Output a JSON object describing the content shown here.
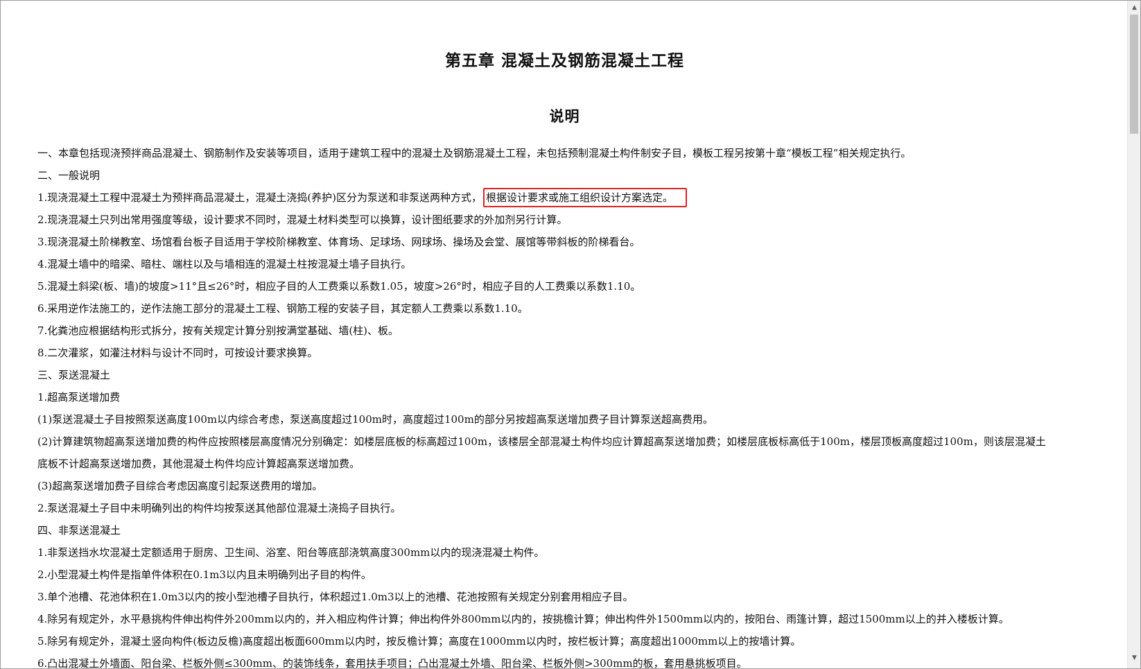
{
  "document": {
    "chapter_title": "第五章  混凝土及钢筋混凝土工程",
    "section_title": "说明",
    "lines": [
      "一、本章包括现浇预拌商品混凝土、钢筋制作及安装等项目，适用于建筑工程中的混凝土及钢筋混凝土工程，未包括预制混凝土构件制安子目，模板工程另按第十章“模板工程”相关规定执行。",
      "二、一般说明",
      "1.现浇混凝土工程中混凝土为预拌商品混凝土，混凝土浇捣(养护)区分为泵送和非泵送两种方式，",
      "2.现浇混凝土只列出常用强度等级，设计要求不同时，混凝土材料类型可以换算，设计图纸要求的外加剂另行计算。",
      "3.现浇混凝土阶梯教室、场馆看台板子目适用于学校阶梯教室、体育场、足球场、网球场、操场及会堂、展馆等带斜板的阶梯看台。",
      "4.混凝土墙中的暗梁、暗柱、端柱以及与墙相连的混凝土柱按混凝土墙子目执行。",
      "5.混凝土斜梁(板、墙)的坡度>11°且≤26°时，相应子目的人工费乘以系数1.05，坡度>26°时，相应子目的人工费乘以系数1.10。",
      "6.采用逆作法施工的，逆作法施工部分的混凝土工程、钢筋工程的安装子目，其定额人工费乘以系数1.10。",
      "7.化粪池应根据结构形式拆分，按有关规定计算分别按满堂基础、墙(柱)、板。",
      "8.二次灌浆，如灌注材料与设计不同时，可按设计要求换算。",
      "三、泵送混凝土",
      "1.超高泵送增加费",
      "(1)泵送混凝土子目按照泵送高度100m以内综合考虑，泵送高度超过100m时，高度超过100m的部分另按超高泵送增加费子目计算泵送超高费用。",
      "(2)计算建筑物超高泵送增加费的构件应按照楼层高度情况分别确定：如楼层底板的标高超过100m，该楼层全部混凝土构件均应计算超高泵送增加费；如楼层底板标高低于100m，楼层顶板高度超过100m，则该层混凝土",
      "底板不计超高泵送增加费，其他混凝土构件均应计算超高泵送增加费。",
      "(3)超高泵送增加费子目综合考虑因高度引起泵送费用的增加。",
      "2.泵送混凝土子目中未明确列出的构件均按泵送其他部位混凝土浇捣子目执行。",
      "四、非泵送混凝土",
      "1.非泵送挡水坎混凝土定额适用于厨房、卫生间、浴室、阳台等底部浇筑高度300mm以内的现浇混凝土构件。",
      "2.小型混凝土构件是指单件体积在0.1m3以内且未明确列出子目的构件。",
      "3.单个池槽、花池体积在1.0m3以内的按小型池槽子目执行，体积超过1.0m3以上的池槽、花池按照有关规定分别套用相应子目。",
      "4.除另有规定外，水平悬挑构件伸出构件外200mm以内的，并入相应构件计算；伸出构件外800mm以内的，按挑檐计算；伸出构件外1500mm以内的，按阳台、雨篷计算，超过1500mm以上的并入楼板计算。",
      "5.除另有规定外，混凝土竖向构件(板边反檐)高度超出板面600mm以内时，按反檐计算；高度在1000mm以内时，按栏板计算；高度超出1000mm以上的按墙计算。",
      "6.凸出混凝土外墙面、阳台梁、栏板外侧≤300mm、的装饰线条，套用扶手项目；凸出混凝土外墙、阳台梁、栏板外侧>300mm的板，套用悬挑板项目。"
    ],
    "highlighted_text": "根据设计要求或施工组织设计方案选定。"
  },
  "scrollbar": {
    "up_icon": "▲",
    "down_icon": "▼"
  },
  "colors": {
    "highlight_border": "#e0201f",
    "text": "#111111",
    "scrollbar_thumb": "#c2c2c2"
  }
}
